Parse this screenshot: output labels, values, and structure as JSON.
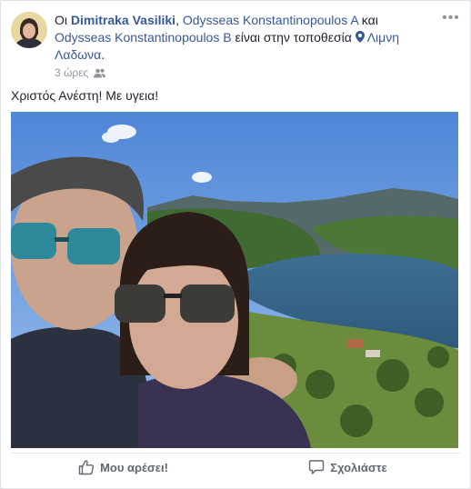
{
  "post": {
    "prefix": "Οι",
    "author": "Dimitraka Vasiliki",
    "sep1": ",",
    "tag1": "Odysseas Konstantinopoulos A",
    "conj": "και",
    "tag2": "Odysseas Konstantinopoulos B",
    "location_text": "είναι στην τοποθεσία",
    "location": "Λιμνη Λαδωνα",
    "end": ".",
    "time": "3 ώρες",
    "audience_icon": "friends-icon",
    "more_icon": "more-options-icon",
    "text": "Χριστός Ανέστη! Με υγεια!"
  },
  "actions": {
    "like_label": "Μου αρέσει!",
    "comment_label": "Σχολιάστε"
  },
  "colors": {
    "link": "#365899",
    "meta": "#90949c",
    "action": "#606770"
  }
}
